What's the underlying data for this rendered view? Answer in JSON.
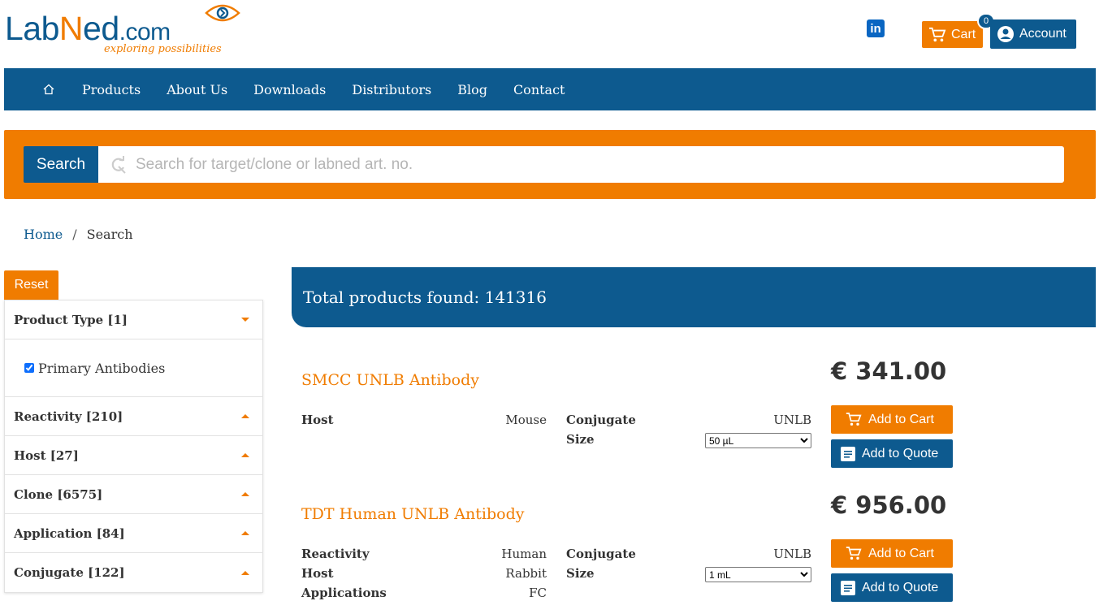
{
  "header": {
    "logo_lab": "Lab",
    "logo_n": "N",
    "logo_ed": "ed",
    "logo_com": ".com",
    "logo_tagline": "exploring possibilities",
    "linkedin": "in",
    "cart_label": "Cart",
    "cart_count": "0",
    "account_label": "Account"
  },
  "nav": {
    "items": [
      "Products",
      "About Us",
      "Downloads",
      "Distributors",
      "Blog",
      "Contact"
    ]
  },
  "search": {
    "button_label": "Search",
    "placeholder": "Search for target/clone or labned art. no."
  },
  "breadcrumb": {
    "home": "Home",
    "separator": "/",
    "current": "Search"
  },
  "sidebar": {
    "reset_label": "Reset",
    "product_type": "Product Type [1]",
    "primary_antibodies": "Primary Antibodies",
    "reactivity": "Reactivity [210]",
    "host": "Host [27]",
    "clone": "Clone [6575]",
    "application": "Application [84]",
    "conjugate": "Conjugate [122]"
  },
  "results": {
    "total": "Total products found: 141316",
    "products": [
      {
        "title": "SMCC UNLB Antibody",
        "price": "€ 341.00",
        "host_label": "Host",
        "host_value": "Mouse",
        "conjugate_label": "Conjugate",
        "conjugate_value": "UNLB",
        "size_label": "Size",
        "size_value": "50 µL",
        "add_cart": "Add to Cart",
        "add_quote": "Add to Quote"
      },
      {
        "title": "TDT Human UNLB Antibody",
        "price": "€ 956.00",
        "reactivity_label": "Reactivity",
        "reactivity_value": "Human",
        "host_label": "Host",
        "host_value": "Rabbit",
        "applications_label": "Applications",
        "applications_value": "FC",
        "conjugate_label": "Conjugate",
        "conjugate_value": "UNLB",
        "size_label": "Size",
        "size_value": "1 mL",
        "add_cart": "Add to Cart",
        "add_quote": "Add to Quote"
      }
    ]
  },
  "colors": {
    "brand_blue": "#0d5a8f",
    "brand_orange": "#f07c00"
  }
}
